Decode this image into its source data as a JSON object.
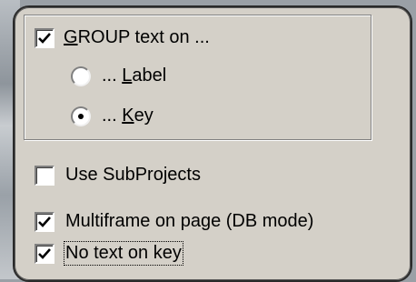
{
  "options": {
    "group_text": {
      "label": "GROUP text on ...",
      "underline_char": "G",
      "rest": "ROUP text on ...",
      "checked": true
    },
    "radio_label": {
      "prefix": "... ",
      "underline_char": "L",
      "rest": "abel",
      "selected": false
    },
    "radio_key": {
      "prefix": "... ",
      "underline_char": "K",
      "rest": "ey",
      "selected": true
    },
    "use_subprojects": {
      "label": "Use SubProjects",
      "checked": false
    },
    "multiframe": {
      "label": "Multiframe on page (DB mode)",
      "checked": true
    },
    "no_text_on_key": {
      "label": "No text on key",
      "checked": true
    }
  },
  "icons": {
    "check": "check-mark-icon",
    "radio_dot": "radio-dot-icon"
  },
  "colors": {
    "panel_bg": "#d4d0c8",
    "border": "#2a2a2a"
  }
}
